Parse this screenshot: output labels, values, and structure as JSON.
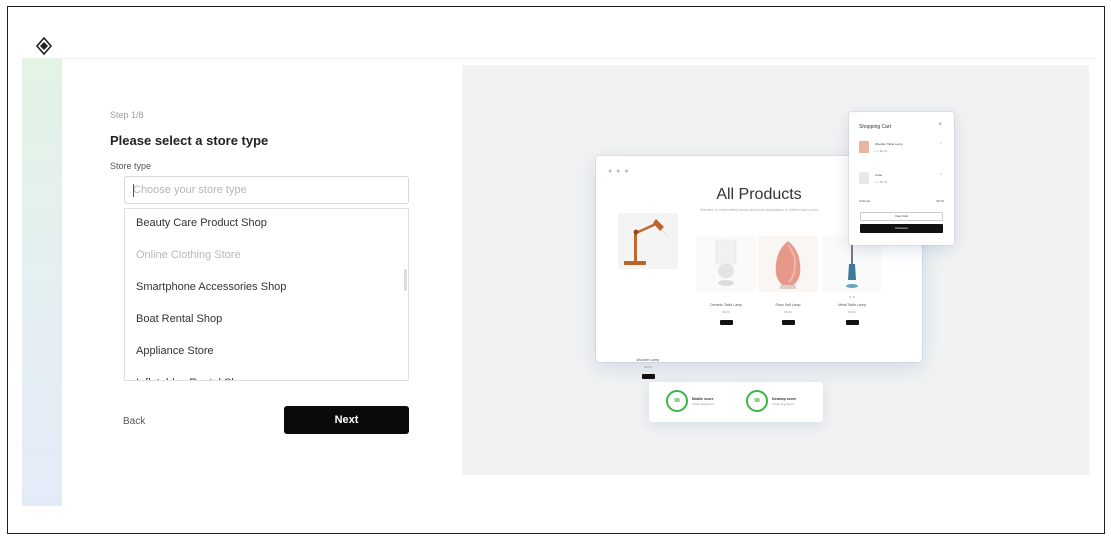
{
  "form": {
    "step": "Step 1/8",
    "title": "Please select a store type",
    "field_label": "Store type",
    "placeholder": "Choose your store type",
    "options": [
      "Beauty Care Product Shop",
      "Online Clothing Store",
      "Smartphone Accessories Shop",
      "Boat Rental Shop",
      "Appliance Store",
      "Inflatables Rental Shop"
    ],
    "back_label": "Back",
    "next_label": "Next"
  },
  "preview": {
    "title": "All Products",
    "subtitle": "Selection of Handcrafted lamps and home decorations to refresh every room",
    "products": [
      {
        "name": "Wooden Lamp",
        "price": "$0.00"
      },
      {
        "name": "Ceramic Table Lamp",
        "price": "$0.00"
      },
      {
        "name": "Rose Salt Lamp",
        "price": "$0.00"
      },
      {
        "name": "Metal Table Lamp",
        "price": "$0.00"
      }
    ],
    "cart": {
      "title": "Shopping Cart",
      "items": [
        {
          "name": "Wooden Table Lamp",
          "qty": "1 x $0.00"
        },
        {
          "name": "Cube",
          "qty": "1 x $0.00"
        }
      ],
      "subtotal_label": "Subtotal",
      "subtotal_value": "$0.00",
      "view_cart": "View Cart",
      "checkout": "Checkout"
    },
    "scores": [
      {
        "value": "98",
        "label": "Mobile score",
        "sub": "Google PageSpeed"
      },
      {
        "value": "98",
        "label": "Desktop score",
        "sub": "Google PageSpeed"
      }
    ]
  },
  "colors": {
    "accent": "#0a0a0a",
    "score_green": "#3cb54a",
    "rail_top": "#e3f3e4",
    "rail_bottom": "#e3ebf8"
  }
}
